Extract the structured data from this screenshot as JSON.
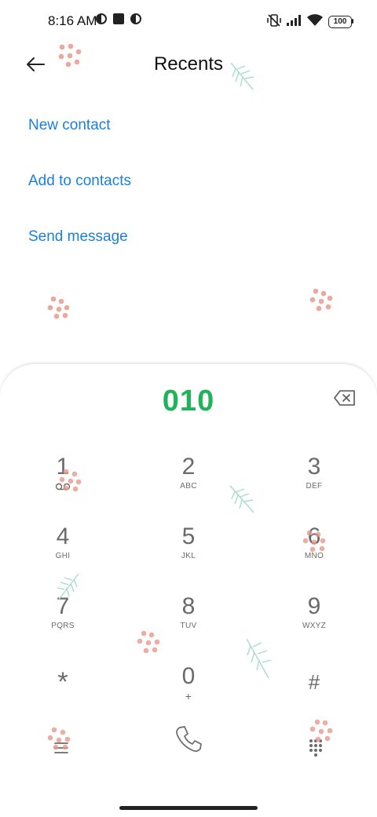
{
  "status_bar": {
    "time": "8:16 AM",
    "battery": "100"
  },
  "header": {
    "title": "Recents"
  },
  "actions": [
    {
      "label": "New contact"
    },
    {
      "label": "Add to contacts"
    },
    {
      "label": "Send message"
    }
  ],
  "dialer": {
    "number": "010"
  },
  "keypad": [
    {
      "digit": "1",
      "letters": ""
    },
    {
      "digit": "2",
      "letters": "ABC"
    },
    {
      "digit": "3",
      "letters": "DEF"
    },
    {
      "digit": "4",
      "letters": "GHI"
    },
    {
      "digit": "5",
      "letters": "JKL"
    },
    {
      "digit": "6",
      "letters": "MNO"
    },
    {
      "digit": "7",
      "letters": "PQRS"
    },
    {
      "digit": "8",
      "letters": "TUV"
    },
    {
      "digit": "9",
      "letters": "WXYZ"
    },
    {
      "digit": "*",
      "letters": ""
    },
    {
      "digit": "0",
      "letters": "+"
    },
    {
      "digit": "#",
      "letters": ""
    }
  ],
  "colors": {
    "accent": "#1a7fdc",
    "number": "#1fb35a",
    "keys": "#6a6a6a"
  },
  "icons": [
    "back-arrow-icon",
    "backspace-icon",
    "voicemail-icon",
    "menu-icon",
    "call-icon",
    "dialpad-icon"
  ]
}
